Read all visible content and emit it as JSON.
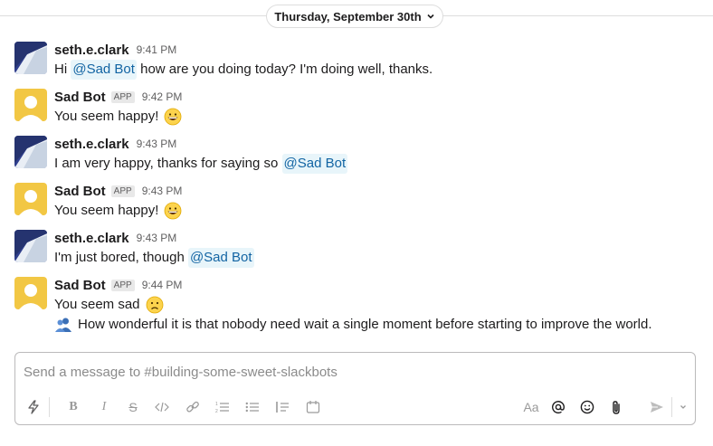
{
  "date_divider": {
    "label": "Thursday, September 30th"
  },
  "users": {
    "seth": {
      "name": "seth.e.clark"
    },
    "bot": {
      "name": "Sad Bot",
      "badge": "APP"
    }
  },
  "messages": [
    {
      "author": "seth.e.clark",
      "time": "9:41 PM",
      "pre": "Hi ",
      "mention": "@Sad Bot",
      "post": " how are you doing today? I'm doing well, thanks."
    },
    {
      "author": "Sad Bot",
      "badge": "APP",
      "time": "9:42 PM",
      "text": "You seem happy!",
      "emoji": "grinning-face-emoji"
    },
    {
      "author": "seth.e.clark",
      "time": "9:43 PM",
      "pre": "I am very happy, thanks for saying so ",
      "mention": "@Sad Bot"
    },
    {
      "author": "Sad Bot",
      "badge": "APP",
      "time": "9:43 PM",
      "text": "You seem happy!",
      "emoji": "grinning-face-emoji"
    },
    {
      "author": "seth.e.clark",
      "time": "9:43 PM",
      "pre": "I'm just bored, though ",
      "mention": "@Sad Bot"
    },
    {
      "author": "Sad Bot",
      "badge": "APP",
      "time": "9:44 PM",
      "text": "You seem sad",
      "emoji": "slightly-frowning-face-emoji",
      "quote": "How wonderful it is that nobody need wait a single moment before starting to improve the world."
    }
  ],
  "composer": {
    "placeholder": "Send a message to #building-some-sweet-slackbots",
    "format_label": "Aa",
    "icons": [
      "lightning-icon",
      "bold-icon",
      "italic-icon",
      "strikethrough-icon",
      "code-icon",
      "link-icon",
      "ordered-list-icon",
      "bulleted-list-icon",
      "blockquote-icon",
      "code-block-icon",
      "format-icon",
      "mention-icon",
      "emoji-icon",
      "attachment-icon",
      "send-icon",
      "send-options-chevron-icon"
    ]
  },
  "colors": {
    "mention_text": "#1264a3",
    "mention_bg": "#e8f5fa",
    "bot_avatar": "#f2c744",
    "border": "#dddddd"
  }
}
